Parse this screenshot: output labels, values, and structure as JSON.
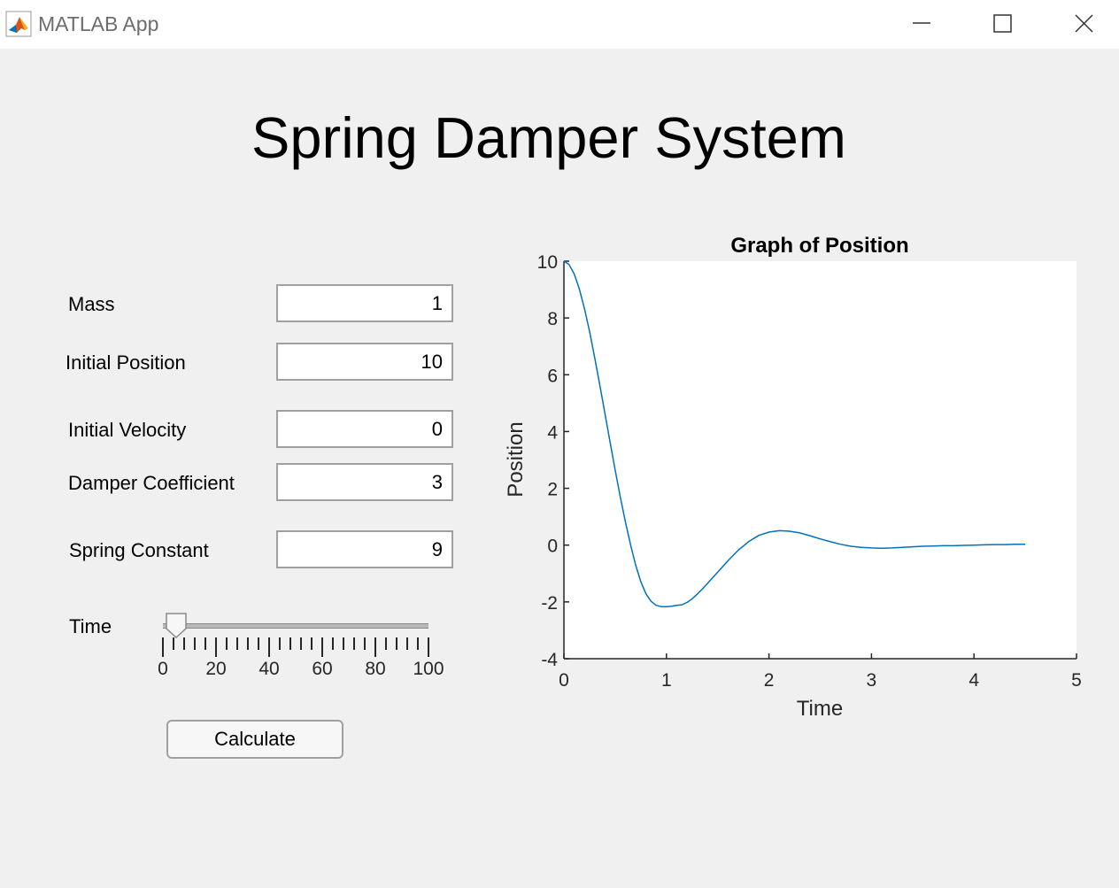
{
  "window": {
    "title": "MATLAB App",
    "controls": [
      "minimize-icon",
      "maximize-icon",
      "close-icon"
    ]
  },
  "app": {
    "heading": "Spring Damper System"
  },
  "form": {
    "mass": {
      "label": "Mass",
      "value": "1"
    },
    "initial_position": {
      "label": "Initial Position",
      "value": "10"
    },
    "initial_velocity": {
      "label": "Initial Velocity",
      "value": "0"
    },
    "damper_coefficient": {
      "label": "Damper Coefficient",
      "value": "3"
    },
    "spring_constant": {
      "label": "Spring Constant",
      "value": "9"
    },
    "time": {
      "label": "Time",
      "min": 0,
      "max": 100,
      "value": 5,
      "tick_labels": [
        "0",
        "20",
        "40",
        "60",
        "80",
        "100"
      ]
    },
    "calculate_label": "Calculate"
  },
  "colors": {
    "background": "#f0f0f0",
    "plot_line": "#0072bd",
    "axis": "#262626"
  },
  "chart_data": {
    "type": "line",
    "title": "Graph of Position",
    "xlabel": "Time",
    "ylabel": "Position",
    "xlim": [
      0,
      5
    ],
    "ylim": [
      -4,
      10
    ],
    "xticks": [
      "0",
      "1",
      "2",
      "3",
      "4",
      "5"
    ],
    "yticks": [
      "-4",
      "-2",
      "0",
      "2",
      "4",
      "6",
      "8",
      "10"
    ],
    "grid": false,
    "series": [
      {
        "x": [
          0,
          0.05,
          0.1,
          0.15,
          0.2,
          0.25,
          0.3,
          0.35,
          0.4,
          0.45,
          0.5,
          0.55,
          0.6,
          0.65,
          0.7,
          0.75,
          0.8,
          0.85,
          0.9,
          0.95,
          1.0,
          1.05,
          1.1,
          1.15,
          1.2,
          1.25,
          1.3,
          1.35,
          1.4,
          1.5,
          1.6,
          1.7,
          1.8,
          1.9,
          2.0,
          2.1,
          2.2,
          2.3,
          2.4,
          2.5,
          2.6,
          2.7,
          2.8,
          2.9,
          3.0,
          3.1,
          3.2,
          3.3,
          3.4,
          3.5,
          3.6,
          3.7,
          3.8,
          3.9,
          4.0,
          4.1,
          4.2,
          4.3,
          4.4,
          4.5
        ],
        "y": [
          10,
          9.88,
          9.55,
          9.02,
          8.33,
          7.52,
          6.61,
          5.64,
          4.64,
          3.63,
          2.64,
          1.69,
          0.81,
          0.01,
          -0.71,
          -1.28,
          -1.71,
          -1.98,
          -2.12,
          -2.17,
          -2.17,
          -2.15,
          -2.12,
          -2.1,
          -2.02,
          -1.89,
          -1.73,
          -1.55,
          -1.35,
          -0.95,
          -0.55,
          -0.18,
          0.12,
          0.34,
          0.46,
          0.51,
          0.49,
          0.43,
          0.33,
          0.22,
          0.12,
          0.03,
          -0.04,
          -0.08,
          -0.1,
          -0.11,
          -0.1,
          -0.08,
          -0.06,
          -0.04,
          -0.03,
          -0.02,
          -0.02,
          -0.01,
          0.0,
          0.01,
          0.02,
          0.02,
          0.03,
          0.03
        ]
      }
    ]
  }
}
